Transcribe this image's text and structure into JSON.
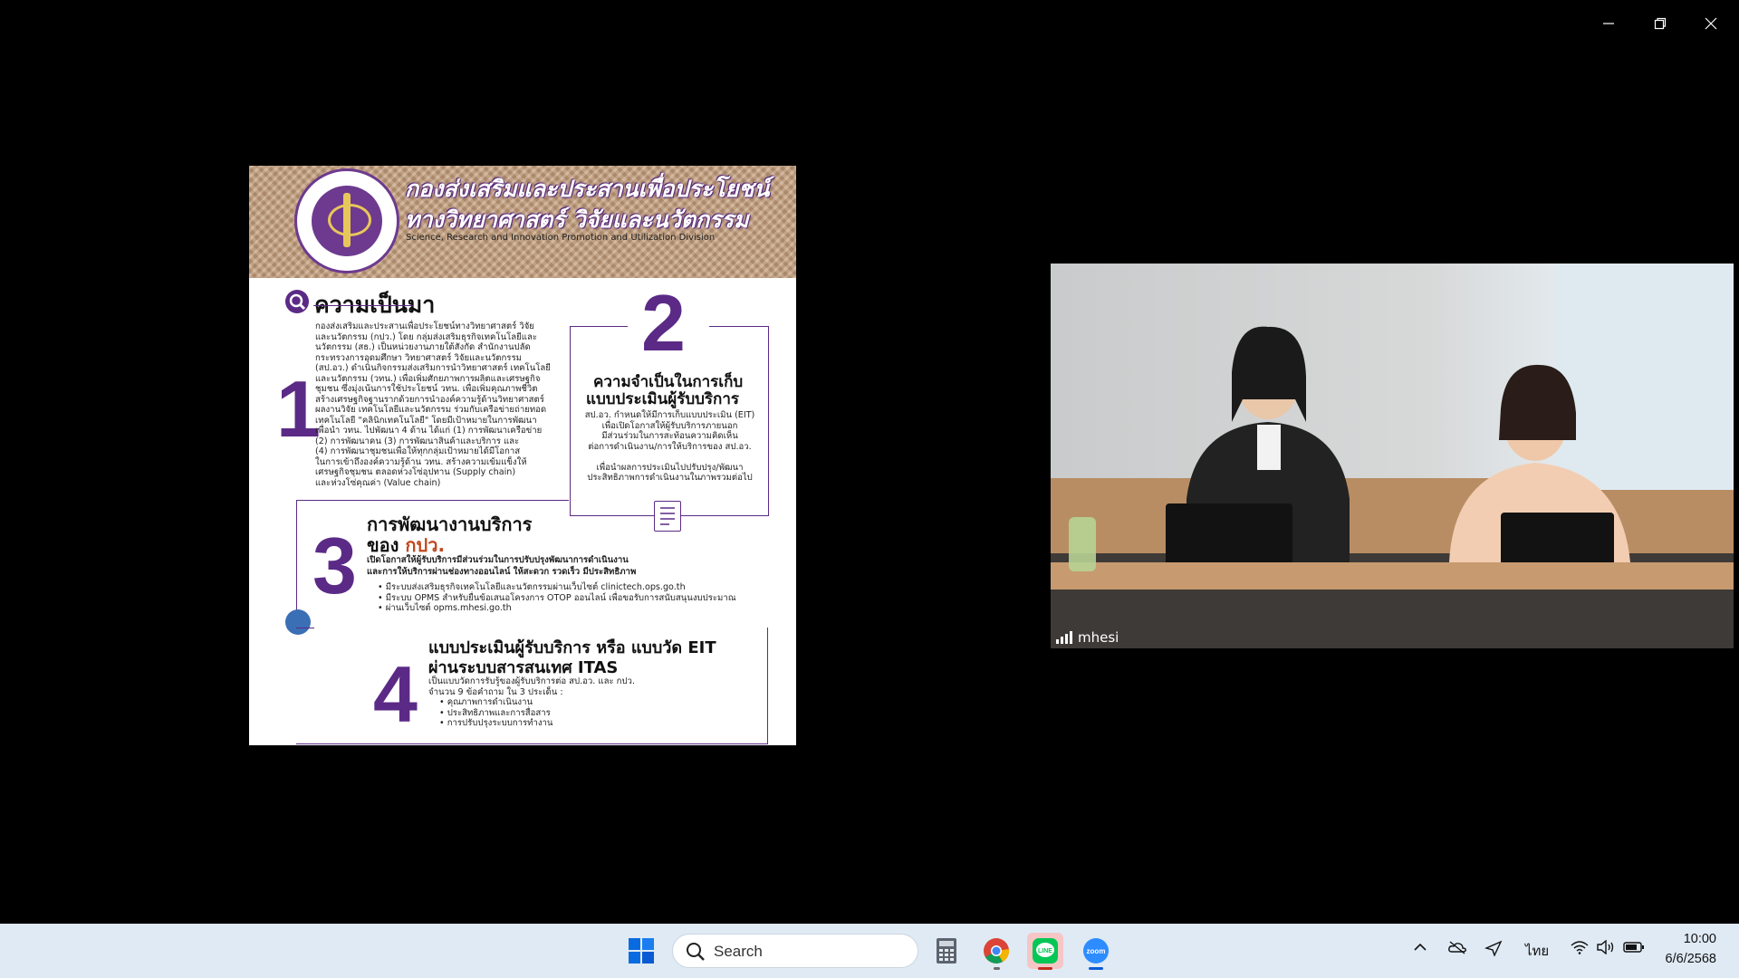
{
  "window": {
    "minimize_icon": "minimize-icon",
    "restore_icon": "restore-icon",
    "close_icon": "close-icon"
  },
  "slide": {
    "header_title_1": "กองส่งเสริมและประสานเพื่อประโยชน์",
    "header_title_2": "ทางวิทยาศาสตร์ วิจัยและนวัตกรรม",
    "header_subtitle": "Science, Research and Innovation Promotion and Utilization Division",
    "sec1": {
      "number": "1",
      "title": "ความเป็นมา",
      "lines": [
        "กองส่งเสริมและประสานเพื่อประโยชน์ทางวิทยาศาสตร์ วิจัย",
        "และนวัตกรรม (กปว.) โดย กลุ่มส่งเสริมธุรกิจเทคโนโลยีและ",
        "นวัตกรรม (สธ.) เป็นหน่วยงานภายใต้สังกัด สำนักงานปลัด",
        "กระทรวงการอุดมศึกษา วิทยาศาสตร์ วิจัยและนวัตกรรม",
        "(สป.อว.) ดำเนินกิจกรรมส่งเสริมการนำวิทยาศาสตร์ เทคโนโลยี",
        "และนวัตกรรม (วทน.) เพื่อเพิ่มศักยภาพการผลิตและเศรษฐกิจ",
        "ชุมชน ซึ่งมุ่งเน้นการใช้ประโยชน์ วทน. เพื่อเพิ่มคุณภาพชีวิต",
        "สร้างเศรษฐกิจฐานรากด้วยการนำองค์ความรู้ด้านวิทยาศาสตร์",
        "ผลงานวิจัย เทคโนโลยีและนวัตกรรม ร่วมกับเครือข่ายถ่ายทอด",
        "เทคโนโลยี \"คลินิกเทคโนโลยี\" โดยมีเป้าหมายในการพัฒนา",
        "เพื่อนำ วทน. ไปพัฒนา 4 ด้าน ได้แก่ (1) การพัฒนาเครือข่าย",
        "(2) การพัฒนาคน (3) การพัฒนาสินค้าและบริการ และ",
        "(4) การพัฒนาชุมชนเพื่อให้ทุกกลุ่มเป้าหมายได้มีโอกาส",
        "ในการเข้าถึงองค์ความรู้ด้าน วทน. สร้างความเข้มแข็งให้",
        "เศรษฐกิจชุมชน ตลอดห่วงโซ่อุปทาน (Supply chain)",
        "และห่วงโซ่คุณค่า (Value chain)"
      ]
    },
    "sec2": {
      "number": "2",
      "title_1": "ความจำเป็นในการเก็บ",
      "title_2": "แบบประเมินผู้รับบริการ",
      "lines": [
        "สป.อว. กำหนดให้มีการเก็บแบบประเมิน (EIT)",
        "เพื่อเปิดโอกาสให้ผู้รับบริการภายนอก",
        "มีส่วนร่วมในการสะท้อนความคิดเห็น",
        "ต่อการดำเนินงาน/การให้บริการของ สป.อว.",
        "",
        "เพื่อนำผลการประเมินไปปรับปรุง/พัฒนา",
        "ประสิทธิภาพการดำเนินงานในภาพรวมต่อไป"
      ]
    },
    "sec3": {
      "number": "3",
      "title_1": "การพัฒนางานบริการ",
      "title_2_prefix": "ของ",
      "title_2_accent": "กปว.",
      "lead_1": "เปิดโอกาสให้ผู้รับบริการมีส่วนร่วมในการปรับปรุงพัฒนาการดำเนินงาน",
      "lead_2": "และการให้บริการผ่านช่องทางออนไลน์ ให้สะดวก รวดเร็ว มีประสิทธิภาพ",
      "bullets": [
        "มีระบบส่งเสริมธุรกิจเทคโนโลยีและนวัตกรรมผ่านเว็บไซต์ clinictech.ops.go.th",
        "มีระบบ OPMS สำหรับยื่นข้อเสนอโครงการ OTOP ออนไลน์ เพื่อขอรับการสนับสนุนงบประมาณ",
        "ผ่านเว็บไซต์ opms.mhesi.go.th"
      ]
    },
    "sec4": {
      "number": "4",
      "title_1": "แบบประเมินผู้รับบริการ หรือ แบบวัด EIT",
      "title_2": "ผ่านระบบสารสนเทศ ITAS",
      "lines": [
        "เป็นแบบวัดการรับรู้ของผู้รับบริการต่อ สป.อว. และ กปว.",
        "จำนวน 9 ข้อคำถาม ใน 3 ประเด็น :"
      ],
      "bullets": [
        "คุณภาพการดำเนินงาน",
        "ประสิทธิภาพและการสื่อสาร",
        "การปรับปรุงระบบการทำงาน"
      ]
    }
  },
  "video": {
    "participant": "mhesi"
  },
  "taskbar": {
    "search_label": "Search",
    "language": "ไทย",
    "time": "10:00",
    "date": "6/6/2568",
    "accent": "#0a5bd3"
  }
}
